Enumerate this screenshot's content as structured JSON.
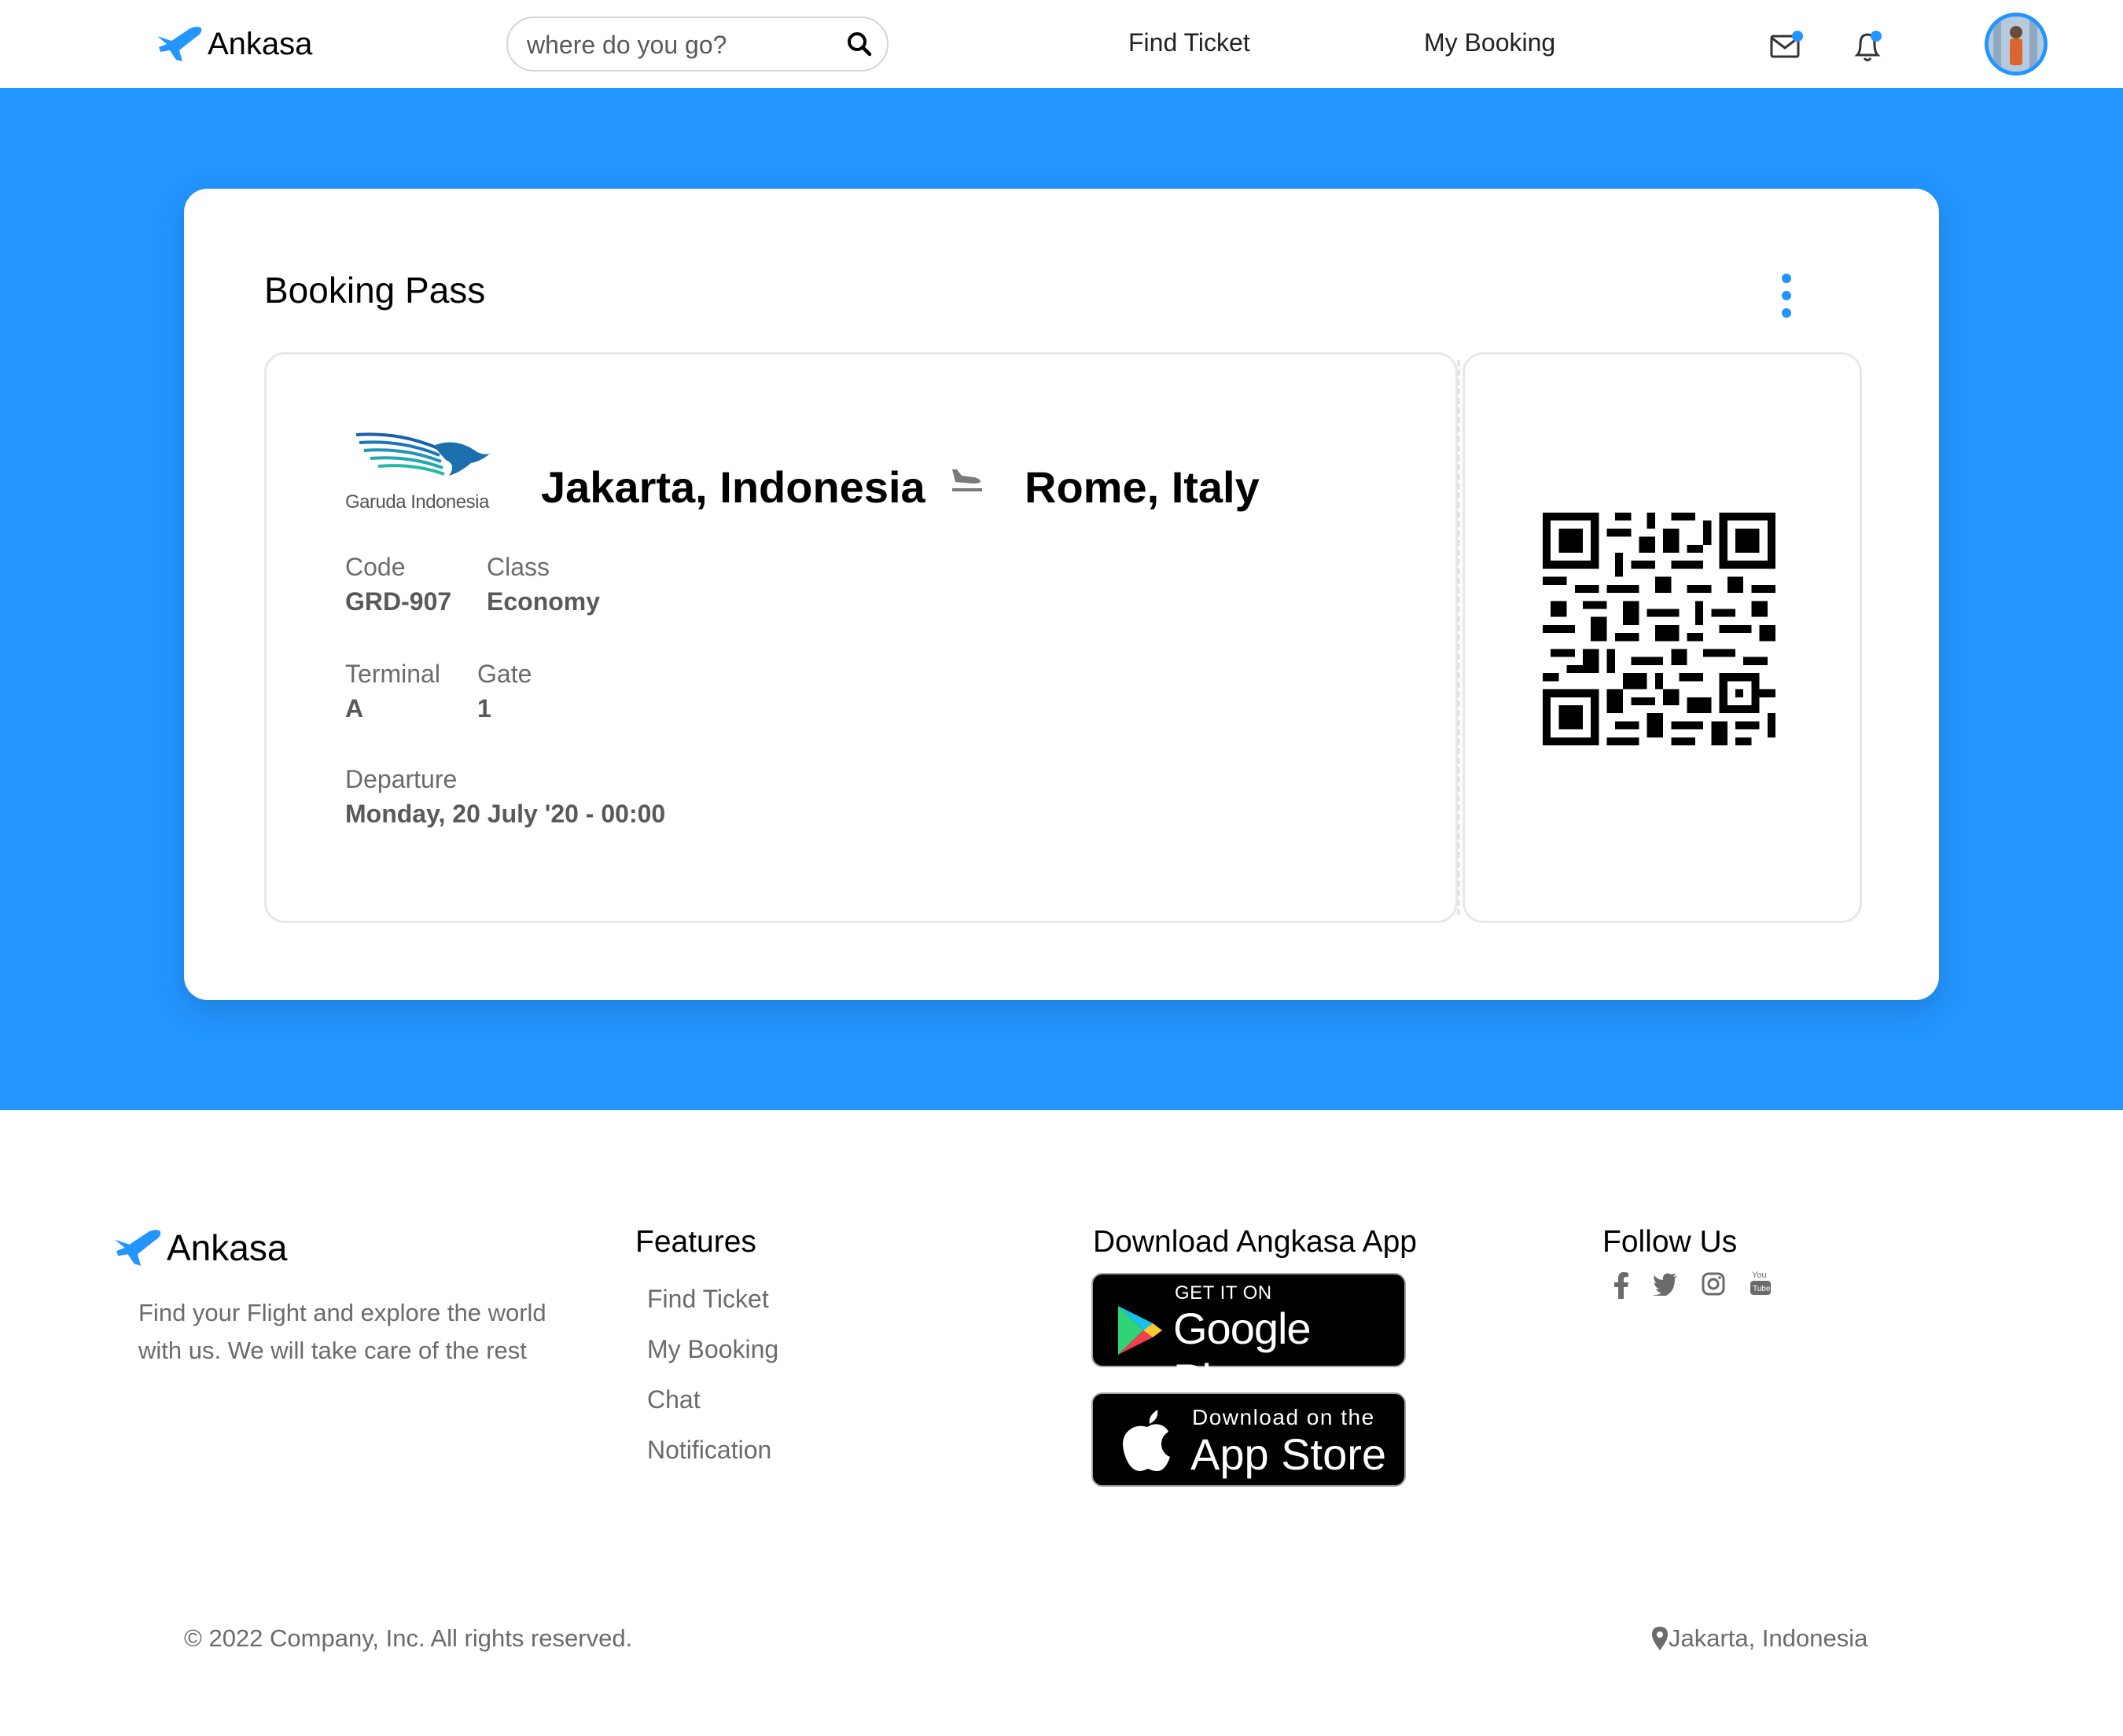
{
  "colors": {
    "accent": "#2395ff",
    "text_dark": "#000000",
    "text_muted": "#6b6b6b"
  },
  "header": {
    "brand": "Ankasa",
    "search": {
      "placeholder": "where do you go?"
    },
    "nav": {
      "find_ticket": "Find Ticket",
      "my_booking": "My Booking"
    },
    "icons": [
      "mail-icon",
      "bell-icon"
    ]
  },
  "booking": {
    "title": "Booking Pass",
    "airline": "Garuda Indonesia",
    "from": "Jakarta, Indonesia",
    "to": "Rome, Italy",
    "fields": {
      "code_label": "Code",
      "code": "GRD-907",
      "class_label": "Class",
      "class": "Economy",
      "terminal_label": "Terminal",
      "terminal": "A",
      "gate_label": "Gate",
      "gate": "1",
      "departure_label": "Departure",
      "departure": "Monday, 20 July '20 - 00:00"
    }
  },
  "footer": {
    "brand": "Ankasa",
    "description": "Find your Flight and explore the world with us. We will take care of the rest",
    "features": {
      "heading": "Features",
      "links": [
        "Find Ticket",
        "My Booking",
        "Chat",
        "Notification"
      ]
    },
    "download": {
      "heading": "Download Angkasa App",
      "google_top": "GET IT ON",
      "google_main": "Google Play",
      "apple_top": "Download on the",
      "apple_main": "App Store"
    },
    "follow": {
      "heading": "Follow Us",
      "icons": [
        "facebook-icon",
        "twitter-icon",
        "instagram-icon",
        "youtube-icon"
      ]
    },
    "copyright": "© 2022 Company, Inc. All rights reserved.",
    "location": "Jakarta, Indonesia"
  }
}
